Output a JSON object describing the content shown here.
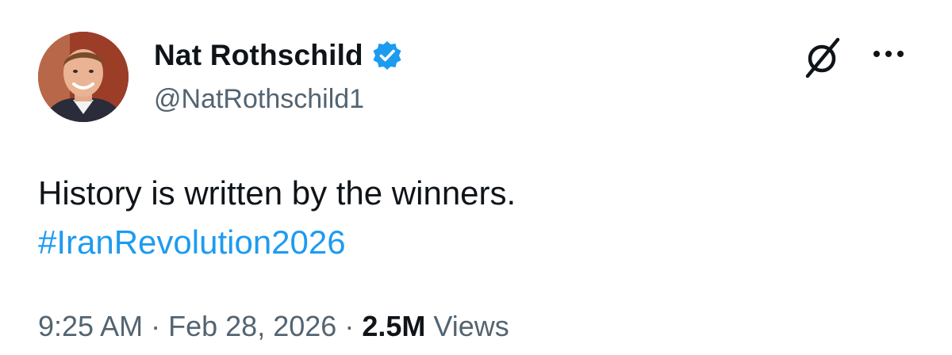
{
  "author": {
    "display_name": "Nat Rothschild",
    "handle": "@NatRothschild1",
    "verified": true,
    "avatar_icon": "profile-photo"
  },
  "header_actions": {
    "grok_icon": "grok-icon",
    "more_icon": "more-icon"
  },
  "tweet": {
    "text": "History is written by the winners.",
    "hashtag": "#IranRevolution2026"
  },
  "meta": {
    "time": "9:25 AM",
    "separator": "·",
    "date": "Feb 28, 2026",
    "views_count": "2.5M",
    "views_label": "Views"
  },
  "colors": {
    "link": "#1d9bf0",
    "verified_badge": "#1d9bf0",
    "secondary_text": "#536471",
    "primary_text": "#0f1419"
  }
}
